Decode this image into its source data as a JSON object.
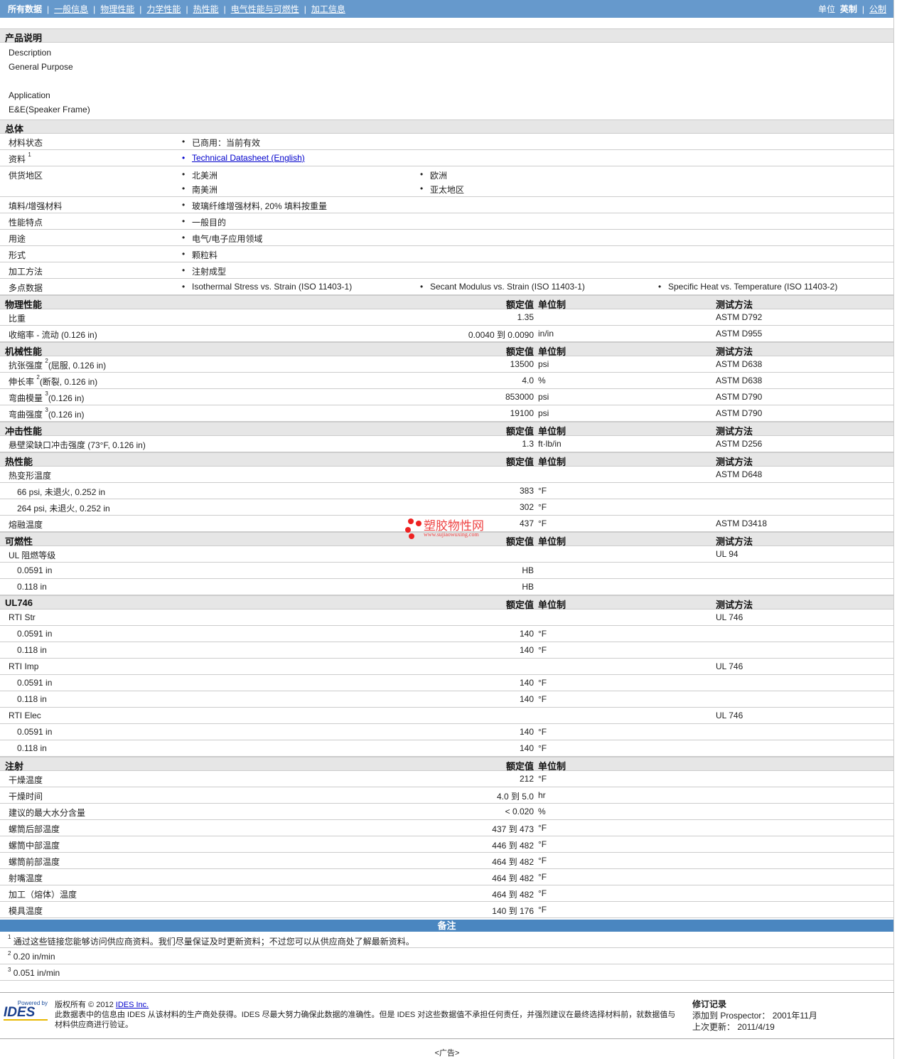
{
  "nav": {
    "items": [
      "所有数据",
      "一般信息",
      "物理性能",
      "力学性能",
      "热性能",
      "电气性能与可燃性",
      "加工信息"
    ],
    "units_label": "单位",
    "english": "英制",
    "metric": "公制"
  },
  "product": {
    "title": "产品说明",
    "lines": [
      "Description",
      "General Purpose",
      "",
      "Application",
      "E&E(Speaker Frame)"
    ]
  },
  "general": {
    "title": "总体",
    "rows": [
      {
        "label": "材料状态",
        "items": [
          "已商用：当前有效"
        ]
      },
      {
        "label": "资料",
        "sup": "1",
        "items": [
          "Technical Datasheet (English)"
        ],
        "link": true
      },
      {
        "label": "供货地区",
        "items": [
          "北美洲",
          "欧洲",
          "南美洲",
          "亚太地区"
        ],
        "grid2": true
      },
      {
        "label": "填料/增强材料",
        "items": [
          "玻璃纤维增强材料, 20% 填料按重量"
        ]
      },
      {
        "label": "性能特点",
        "items": [
          "一般目的"
        ]
      },
      {
        "label": "用途",
        "items": [
          "电气/电子应用领域"
        ]
      },
      {
        "label": "形式",
        "items": [
          "颗粒料"
        ]
      },
      {
        "label": "加工方法",
        "items": [
          "注射成型"
        ]
      },
      {
        "label": "多点数据",
        "items": [
          "Isothermal Stress vs. Strain (ISO 11403-1)",
          "Secant Modulus vs. Strain (ISO 11403-1)",
          "Specific Heat vs. Temperature (ISO 11403-2)"
        ]
      }
    ]
  },
  "headers": {
    "value": "额定值",
    "unit": "单位制",
    "method": "测试方法"
  },
  "sections": [
    {
      "title": "物理性能",
      "method": true,
      "rows": [
        {
          "label": "比重",
          "value": "1.35",
          "method": "ASTM D792"
        },
        {
          "label": "收缩率  - 流动  (0.126 in)",
          "value": "0.0040 到  0.0090",
          "unit": "in/in",
          "method": "ASTM D955"
        }
      ]
    },
    {
      "title": "机械性能",
      "method": true,
      "rows": [
        {
          "label": "抗张强度",
          "sup": "2",
          "suffix": "(屈服, 0.126 in)",
          "value": "13500",
          "unit": "psi",
          "method": "ASTM D638"
        },
        {
          "label": "伸长率",
          "sup": "2",
          "suffix": "(断裂, 0.126 in)",
          "value": "4.0",
          "unit": "%",
          "method": "ASTM D638"
        },
        {
          "label": "弯曲模量",
          "sup": "3",
          "suffix": "(0.126 in)",
          "value": "853000",
          "unit": "psi",
          "method": "ASTM D790"
        },
        {
          "label": "弯曲强度",
          "sup": "3",
          "suffix": "(0.126 in)",
          "value": "19100",
          "unit": "psi",
          "method": "ASTM D790"
        }
      ]
    },
    {
      "title": "冲击性能",
      "method": true,
      "rows": [
        {
          "label": "悬壁梁缺口冲击强度  (73°F, 0.126 in)",
          "value": "1.3",
          "unit": "ft·lb/in",
          "method": "ASTM D256"
        }
      ]
    },
    {
      "title": "热性能",
      "method": true,
      "rows": [
        {
          "label": "热变形温度",
          "method": "ASTM D648"
        },
        {
          "label": "66 psi, 未退火, 0.252 in",
          "indent": true,
          "value": "383",
          "unit": "°F"
        },
        {
          "label": "264 psi, 未退火, 0.252 in",
          "indent": true,
          "value": "302",
          "unit": "°F"
        },
        {
          "label": "熔融温度",
          "value": "437",
          "unit": "°F",
          "method": "ASTM D3418"
        }
      ]
    },
    {
      "title": "可燃性",
      "method": true,
      "rows": [
        {
          "label": "UL 阻燃等级",
          "method": "UL 94"
        },
        {
          "label": "0.0591 in",
          "indent": true,
          "value": "HB"
        },
        {
          "label": "0.118 in",
          "indent": true,
          "value": "HB"
        }
      ]
    },
    {
      "title": "UL746",
      "method": true,
      "rows": [
        {
          "label": "RTI Str",
          "method": "UL 746"
        },
        {
          "label": "0.0591 in",
          "indent": true,
          "value": "140",
          "unit": "°F"
        },
        {
          "label": "0.118 in",
          "indent": true,
          "value": "140",
          "unit": "°F"
        },
        {
          "label": "RTI Imp",
          "method": "UL 746"
        },
        {
          "label": "0.0591 in",
          "indent": true,
          "value": "140",
          "unit": "°F"
        },
        {
          "label": "0.118 in",
          "indent": true,
          "value": "140",
          "unit": "°F"
        },
        {
          "label": "RTI Elec",
          "method": "UL 746"
        },
        {
          "label": "0.0591 in",
          "indent": true,
          "value": "140",
          "unit": "°F"
        },
        {
          "label": "0.118 in",
          "indent": true,
          "value": "140",
          "unit": "°F"
        }
      ]
    },
    {
      "title": "注射",
      "method": false,
      "rows": [
        {
          "label": "干燥温度",
          "value": "212",
          "unit": "°F"
        },
        {
          "label": "干燥时间",
          "value": "4.0 到  5.0",
          "unit": "hr"
        },
        {
          "label": "建议的最大水分含量",
          "value": "< 0.020",
          "unit": "%"
        },
        {
          "label": "螺筒后部温度",
          "value": "437 到  473",
          "unit": "°F"
        },
        {
          "label": "螺筒中部温度",
          "value": "446 到  482",
          "unit": "°F"
        },
        {
          "label": "螺筒前部温度",
          "value": "464 到  482",
          "unit": "°F"
        },
        {
          "label": "射嘴温度",
          "value": "464 到  482",
          "unit": "°F"
        },
        {
          "label": "加工（熔体）温度",
          "value": "464 到  482",
          "unit": "°F"
        },
        {
          "label": "模具温度",
          "value": "140 到  176",
          "unit": "°F"
        }
      ]
    }
  ],
  "notes": {
    "title": "备注",
    "items": [
      {
        "sup": "1",
        "text": "通过这些链接您能够访问供应商资料。我们尽量保证及时更新资料；不过您可以从供应商处了解最新资料。"
      },
      {
        "sup": "2",
        "text": "0.20 in/min"
      },
      {
        "sup": "3",
        "text": "0.051 in/min"
      }
    ]
  },
  "watermark": {
    "name": "塑胶物性网",
    "url": "www.sujiaowuxing.com"
  },
  "footer": {
    "logo_powered": "Powered by",
    "logo_text": "IDES",
    "copyright": "版权所有  © 2012",
    "company_link": "IDES Inc.",
    "disclaimer": "此数据表中的信息由  IDES 从该材料的生产商处获得。IDES 尽最大努力确保此数据的准确性。但是  IDES 对这些数据值不承担任何责任，并强烈建议在最终选择材料前，就数据值与材料供应商进行验证。",
    "rev_title": "修订记录",
    "added": "添加到  Prospector：  2001年11月",
    "updated": "上次更新：  2011/4/19",
    "ad": "<广告>"
  }
}
